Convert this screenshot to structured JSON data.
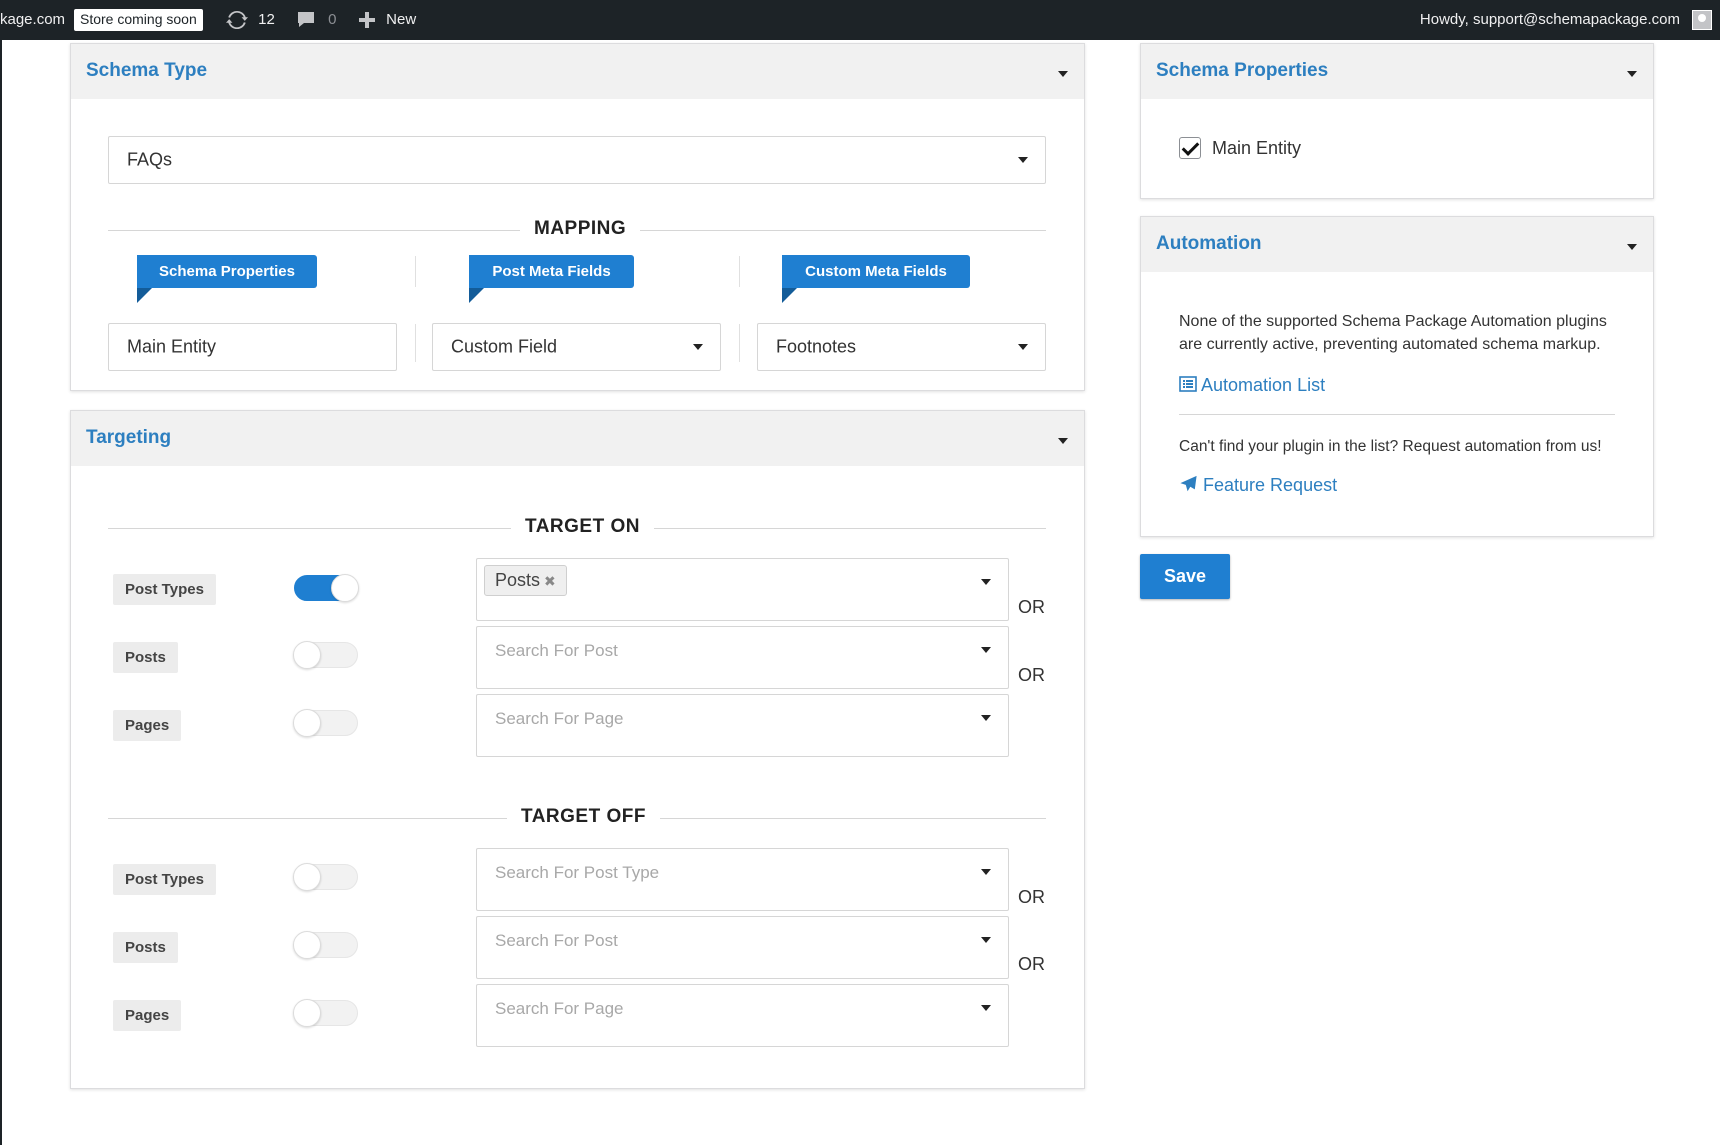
{
  "admin_bar": {
    "site_fragment": "kage.com",
    "store_badge": "Store coming soon",
    "updates_count": "12",
    "comments_count": "0",
    "new_label": "New",
    "howdy": "Howdy, support@schemapackage.com"
  },
  "schema_type_panel": {
    "title": "Schema Type",
    "selected_type": "FAQs",
    "mapping": {
      "heading": "MAPPING",
      "columns": [
        {
          "ribbon": "Schema Properties",
          "value": "Main Entity"
        },
        {
          "ribbon": "Post Meta Fields",
          "value": "Custom Field"
        },
        {
          "ribbon": "Custom Meta Fields",
          "value": "Footnotes"
        }
      ]
    }
  },
  "targeting_panel": {
    "title": "Targeting",
    "target_on": {
      "heading": "TARGET ON",
      "rows": [
        {
          "label": "Post Types",
          "enabled": true,
          "chip": "Posts",
          "placeholder": "",
          "joiner": "OR"
        },
        {
          "label": "Posts",
          "enabled": false,
          "chip": "",
          "placeholder": "Search For Post",
          "joiner": "OR"
        },
        {
          "label": "Pages",
          "enabled": false,
          "chip": "",
          "placeholder": "Search For Page",
          "joiner": ""
        }
      ]
    },
    "target_off": {
      "heading": "TARGET OFF",
      "rows": [
        {
          "label": "Post Types",
          "enabled": false,
          "placeholder": "Search For Post Type",
          "joiner": "OR"
        },
        {
          "label": "Posts",
          "enabled": false,
          "placeholder": "Search For Post",
          "joiner": "OR"
        },
        {
          "label": "Pages",
          "enabled": false,
          "placeholder": "Search For Page",
          "joiner": ""
        }
      ]
    }
  },
  "schema_properties_panel": {
    "title": "Schema Properties",
    "checkbox_label": "Main Entity",
    "checked": true
  },
  "automation_panel": {
    "title": "Automation",
    "notice_line1": "None of the supported Schema Package Automation plugins",
    "notice_line2": "are currently active, preventing automated schema markup.",
    "automation_list_link": "Automation List",
    "request_text": "Can't find your plugin in the list? Request automation from us!",
    "feature_request_link": "Feature Request"
  },
  "save_button": "Save",
  "colors": {
    "accent": "#1f7fd1",
    "title_blue": "#2d7fc0",
    "admin_bar": "#1d2327"
  },
  "icons": [
    "refresh-icon",
    "comment-icon",
    "plus-icon",
    "avatar",
    "list-icon",
    "paper-plane-icon",
    "caret-down-icon",
    "check-icon"
  ]
}
